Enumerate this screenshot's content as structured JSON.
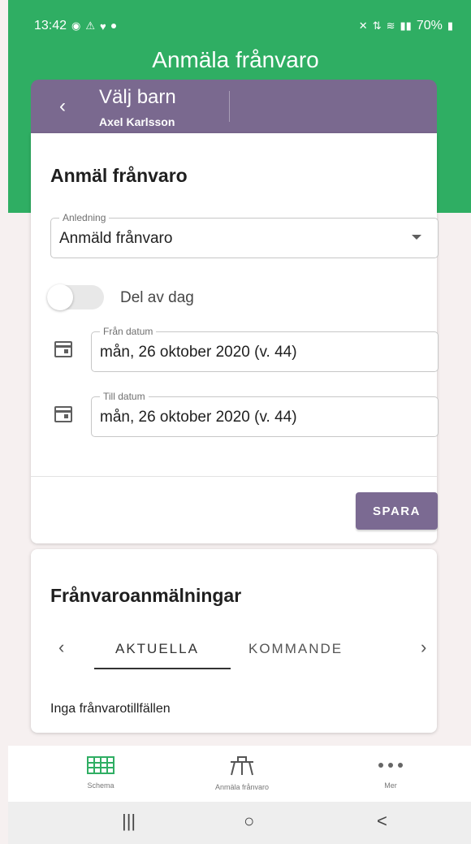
{
  "status_bar": {
    "time": "13:42",
    "battery": "70%"
  },
  "app": {
    "title": "Anmäla frånvaro"
  },
  "child_selector": {
    "title": "Välj barn",
    "child_name": "Axel Karlsson"
  },
  "absence_form": {
    "title": "Anmäl frånvaro",
    "reason_label": "Anledning",
    "reason_value": "Anmäld frånvaro",
    "part_of_day_label": "Del av dag",
    "from_label": "Från datum",
    "from_value": "mån, 26 oktober 2020 (v. 44)",
    "to_label": "Till datum",
    "to_value": "mån, 26 oktober 2020 (v. 44)",
    "save_label": "SPARA"
  },
  "notifications": {
    "title": "Frånvaroanmälningar",
    "tabs": [
      "AKTUELLA",
      "KOMMANDE"
    ],
    "empty_text": "Inga frånvarotillfällen"
  },
  "bottom_nav": [
    {
      "label": "Schema",
      "icon": "schedule-icon"
    },
    {
      "label": "Anmäla frånvaro",
      "icon": "desk-icon"
    },
    {
      "label": "Mer",
      "icon": "more-icon"
    }
  ],
  "system_nav": {
    "recent_symbol": "|||",
    "home_symbol": "○",
    "back_symbol": "<"
  },
  "colors": {
    "header_green": "#2fae63",
    "child_bar_purple": "#7a698f",
    "button_purple": "#7b6a92",
    "background": "#f6f0f0"
  }
}
